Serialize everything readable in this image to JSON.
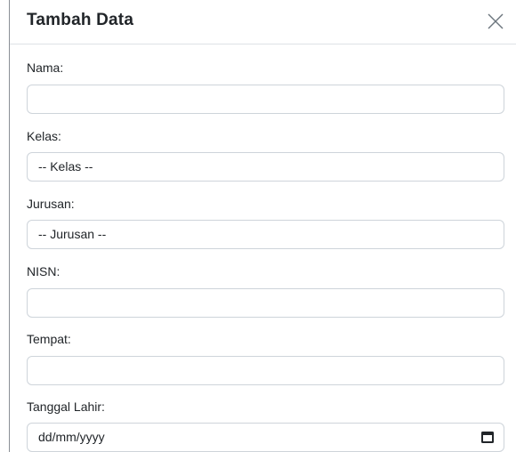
{
  "modal": {
    "title": "Tambah Data"
  },
  "form": {
    "nama": {
      "label": "Nama:",
      "value": ""
    },
    "kelas": {
      "label": "Kelas:",
      "selected": "-- Kelas --"
    },
    "jurusan": {
      "label": "Jurusan:",
      "selected": "-- Jurusan --"
    },
    "nisn": {
      "label": "NISN:",
      "value": ""
    },
    "tempat": {
      "label": "Tempat:",
      "value": ""
    },
    "tanggal_lahir": {
      "label": "Tanggal Lahir:",
      "placeholder": "dd/mm/yyyy"
    }
  },
  "icons": {
    "close": "close-icon",
    "calendar": "calendar-icon"
  }
}
